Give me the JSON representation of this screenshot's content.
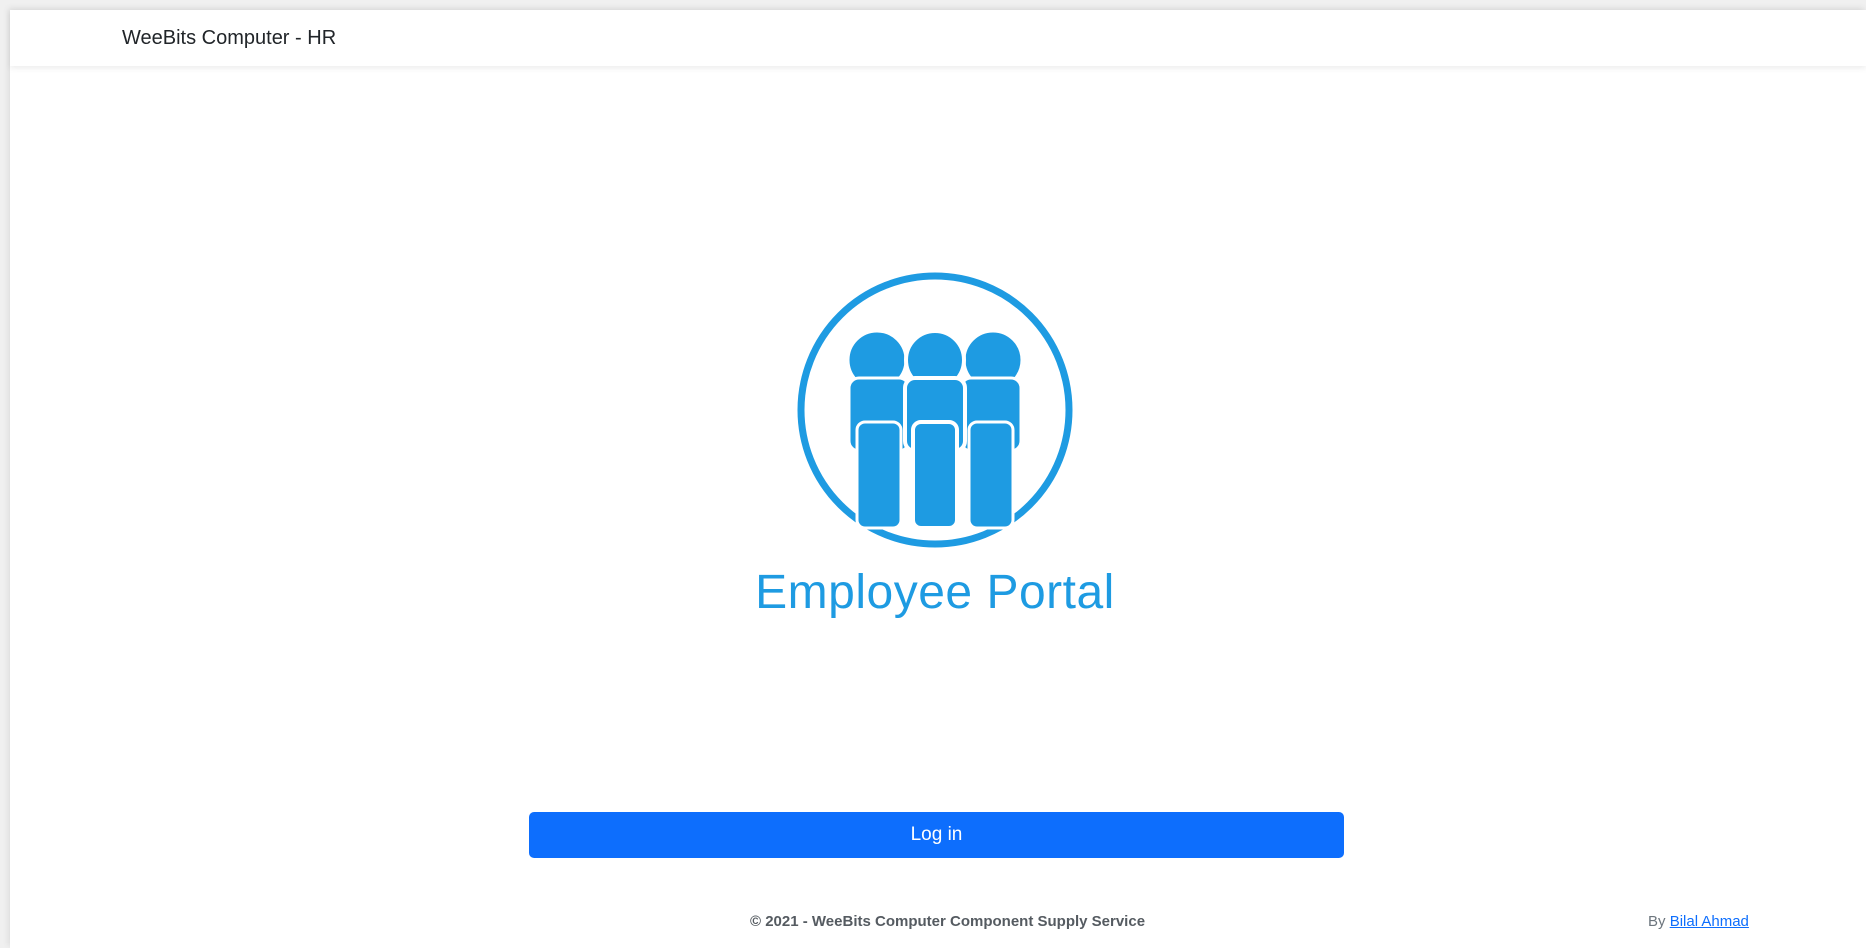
{
  "navbar": {
    "brand": "WeeBits Computer - HR"
  },
  "hero": {
    "logo_icon": "employees-group-icon",
    "title": "Employee Portal",
    "color": "#1e9be2"
  },
  "login": {
    "label": "Log in",
    "color": "#0d6efd"
  },
  "footer": {
    "copyright": "© 2021 - WeeBits Computer Component Supply Service",
    "by_prefix": "By",
    "author": "Bilal Ahmad"
  }
}
